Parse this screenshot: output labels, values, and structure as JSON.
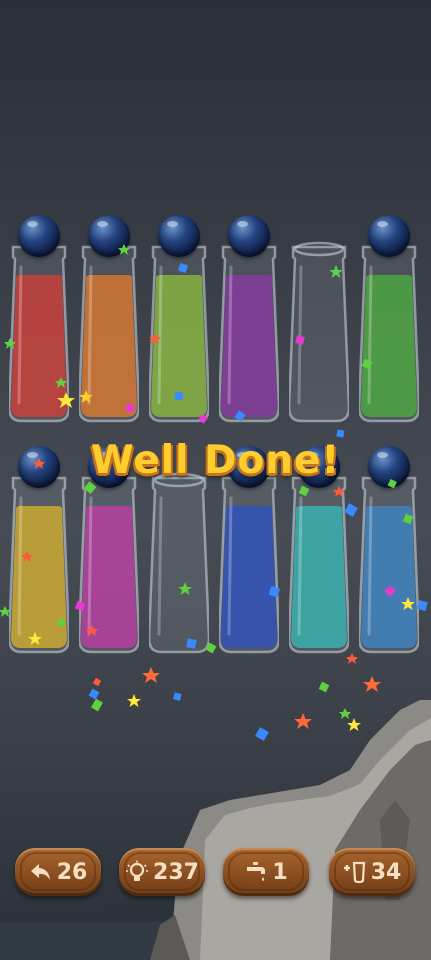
{
  "message": "Well Done!",
  "tubes": [
    {
      "color": "#c62a24",
      "capped": true
    },
    {
      "color": "#d5681a",
      "capped": true
    },
    {
      "color": "#7bab2a",
      "capped": true
    },
    {
      "color": "#7a2594",
      "capped": true
    },
    {
      "color": null,
      "capped": false
    },
    {
      "color": "#3c9e2c",
      "capped": true
    },
    {
      "color": "#c9a21a",
      "capped": true
    },
    {
      "color": "#b12a96",
      "capped": true
    },
    {
      "color": null,
      "capped": false
    },
    {
      "color": "#1c3fb3",
      "capped": true
    },
    {
      "color": "#24aaa7",
      "capped": true
    },
    {
      "color": "#2b77b9",
      "capped": true
    }
  ],
  "buttons": {
    "undo": {
      "icon": "undo-icon",
      "value": "26"
    },
    "hint": {
      "icon": "lightbulb-icon",
      "value": "237"
    },
    "tap": {
      "icon": "faucet-icon",
      "value": "1"
    },
    "add_tube": {
      "icon": "add-tube-icon",
      "value": "34"
    }
  }
}
